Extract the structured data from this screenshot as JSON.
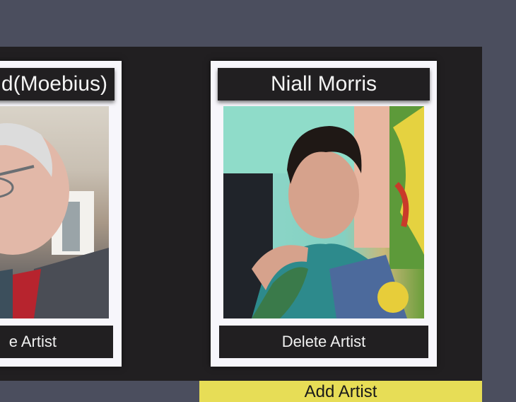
{
  "artists": [
    {
      "name": "ud(Moebius)",
      "delete_label": "e Artist"
    },
    {
      "name": "Niall Morris",
      "delete_label": "Delete Artist"
    }
  ],
  "add_label": "Add Artist",
  "colors": {
    "page_background": "#4b4e5e",
    "panel_background": "#211f21",
    "card_background": "#f7f6fb",
    "button_background": "#211f21",
    "add_button": "#e7dd56"
  }
}
